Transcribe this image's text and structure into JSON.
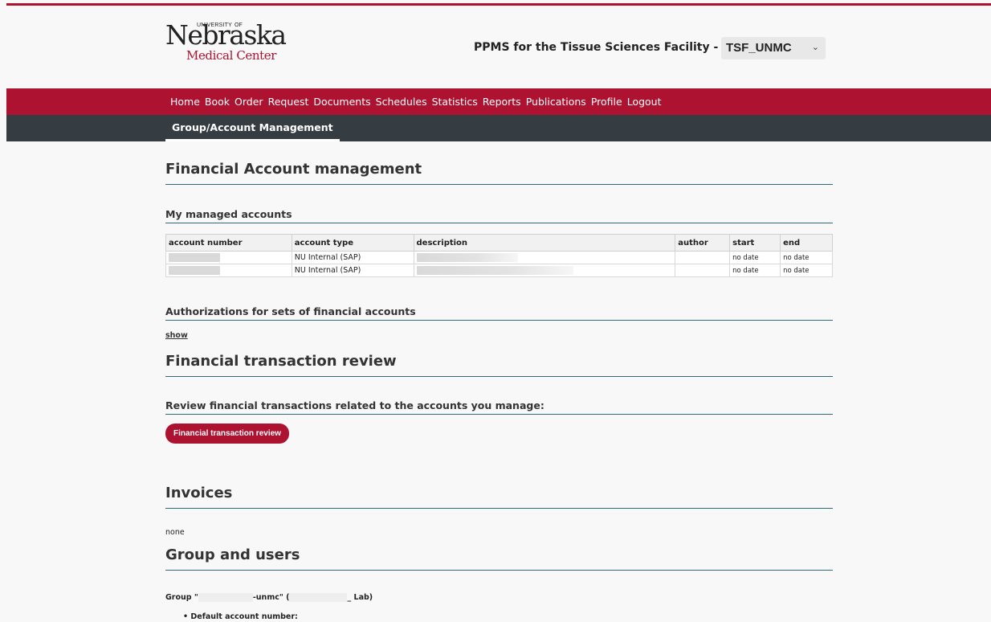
{
  "header": {
    "logo": {
      "name_line": "Nebraska",
      "top_left": "UNIVERSITY",
      "top_right": "OF",
      "bottom": "Medical Center"
    },
    "site_title": "PPMS for the Tissue Sciences Facility -",
    "facility_select": {
      "selected": "TSF_UNMC"
    }
  },
  "nav": {
    "items": [
      "Home",
      "Book",
      "Order",
      "Request",
      "Documents",
      "Schedules",
      "Statistics",
      "Reports",
      "Publications",
      "Profile",
      "Logout"
    ]
  },
  "subnav": {
    "active_tab": "Group/Account Management"
  },
  "financial": {
    "title": "Financial Account management",
    "managed_accounts": {
      "title": "My managed accounts",
      "columns": [
        "account number",
        "account type",
        "description",
        "author",
        "start",
        "end"
      ],
      "rows": [
        {
          "account_number": "",
          "account_type": "NU Internal (SAP)",
          "description": "",
          "author": "",
          "start": "no date",
          "end": "no date"
        },
        {
          "account_number": "",
          "account_type": "NU Internal (SAP)",
          "description": "",
          "author": "",
          "start": "no date",
          "end": "no date"
        }
      ]
    },
    "authorizations": {
      "title": "Authorizations for sets of financial accounts",
      "show_link": "show"
    }
  },
  "transaction_review": {
    "title": "Financial transaction review",
    "subtitle": "Review financial transactions related to the accounts you manage:",
    "button_label": "Financial transaction review"
  },
  "invoices": {
    "title": "Invoices",
    "value": "none"
  },
  "group_users": {
    "title": "Group and users",
    "group_prefix": "Group \"",
    "group_middle": "-unmc\" (",
    "group_suffix": "Lab)",
    "default_account_label": "Default account number:"
  },
  "colors": {
    "brand_red": "#ad1230",
    "subnav_dark": "#353d42",
    "rule_teal": "#2e6a78"
  },
  "icons": {
    "select_caret": "chevron-down-icon"
  }
}
